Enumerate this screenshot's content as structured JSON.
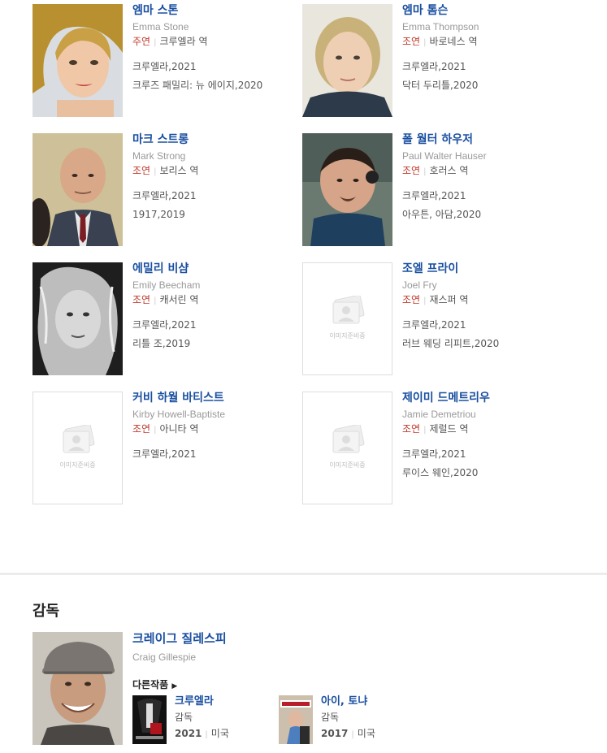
{
  "cast": [
    {
      "name_kr": "엠마 스톤",
      "name_en": "Emma Stone",
      "role_type": "주연",
      "role": "크루엘라 역",
      "works": [
        "크루엘라,2021",
        "크루즈 패밀리: 뉴 에이지,2020"
      ]
    },
    {
      "name_kr": "엠마 톰슨",
      "name_en": "Emma Thompson",
      "role_type": "조연",
      "role": "바로네스 역",
      "works": [
        "크루엘라,2021",
        "닥터 두리틀,2020"
      ]
    },
    {
      "name_kr": "마크 스트롱",
      "name_en": "Mark Strong",
      "role_type": "조연",
      "role": "보리스 역",
      "works": [
        "크루엘라,2021",
        "1917,2019"
      ]
    },
    {
      "name_kr": "폴 월터 하우저",
      "name_en": "Paul Walter Hauser",
      "role_type": "조연",
      "role": "호러스 역",
      "works": [
        "크루엘라,2021",
        "아우튼, 아담,2020"
      ]
    },
    {
      "name_kr": "에밀리 비샴",
      "name_en": "Emily Beecham",
      "role_type": "조연",
      "role": "캐서린 역",
      "works": [
        "크루엘라,2021",
        "리틀 조,2019"
      ]
    },
    {
      "name_kr": "조엘 프라이",
      "name_en": "Joel Fry",
      "role_type": "조연",
      "role": "재스퍼 역",
      "works": [
        "크루엘라,2021",
        "러브 웨딩 리피트,2020"
      ]
    },
    {
      "name_kr": "커비 하월 바티스트",
      "name_en": "Kirby Howell-Baptiste",
      "role_type": "조연",
      "role": "아니타 역",
      "works": [
        "크루엘라,2021"
      ]
    },
    {
      "name_kr": "제이미 드메트리우",
      "name_en": "Jamie Demetriou",
      "role_type": "조연",
      "role": "제럴드 역",
      "works": [
        "크루엘라,2021",
        "루이스 웨인,2020"
      ]
    }
  ],
  "no_image_label": "이미지준비중",
  "director_section": {
    "title": "감독",
    "name_kr": "크레이그 질레스피",
    "name_en": "Craig Gillespie",
    "more_label": "다른작품",
    "films": [
      {
        "title": "크루엘라",
        "role": "감독",
        "year": "2021",
        "country": "미국"
      },
      {
        "title": "아이, 토냐",
        "role": "감독",
        "year": "2017",
        "country": "미국"
      }
    ]
  },
  "colors": {
    "link": "#1a4fa0",
    "role_type": "#c0392b"
  }
}
